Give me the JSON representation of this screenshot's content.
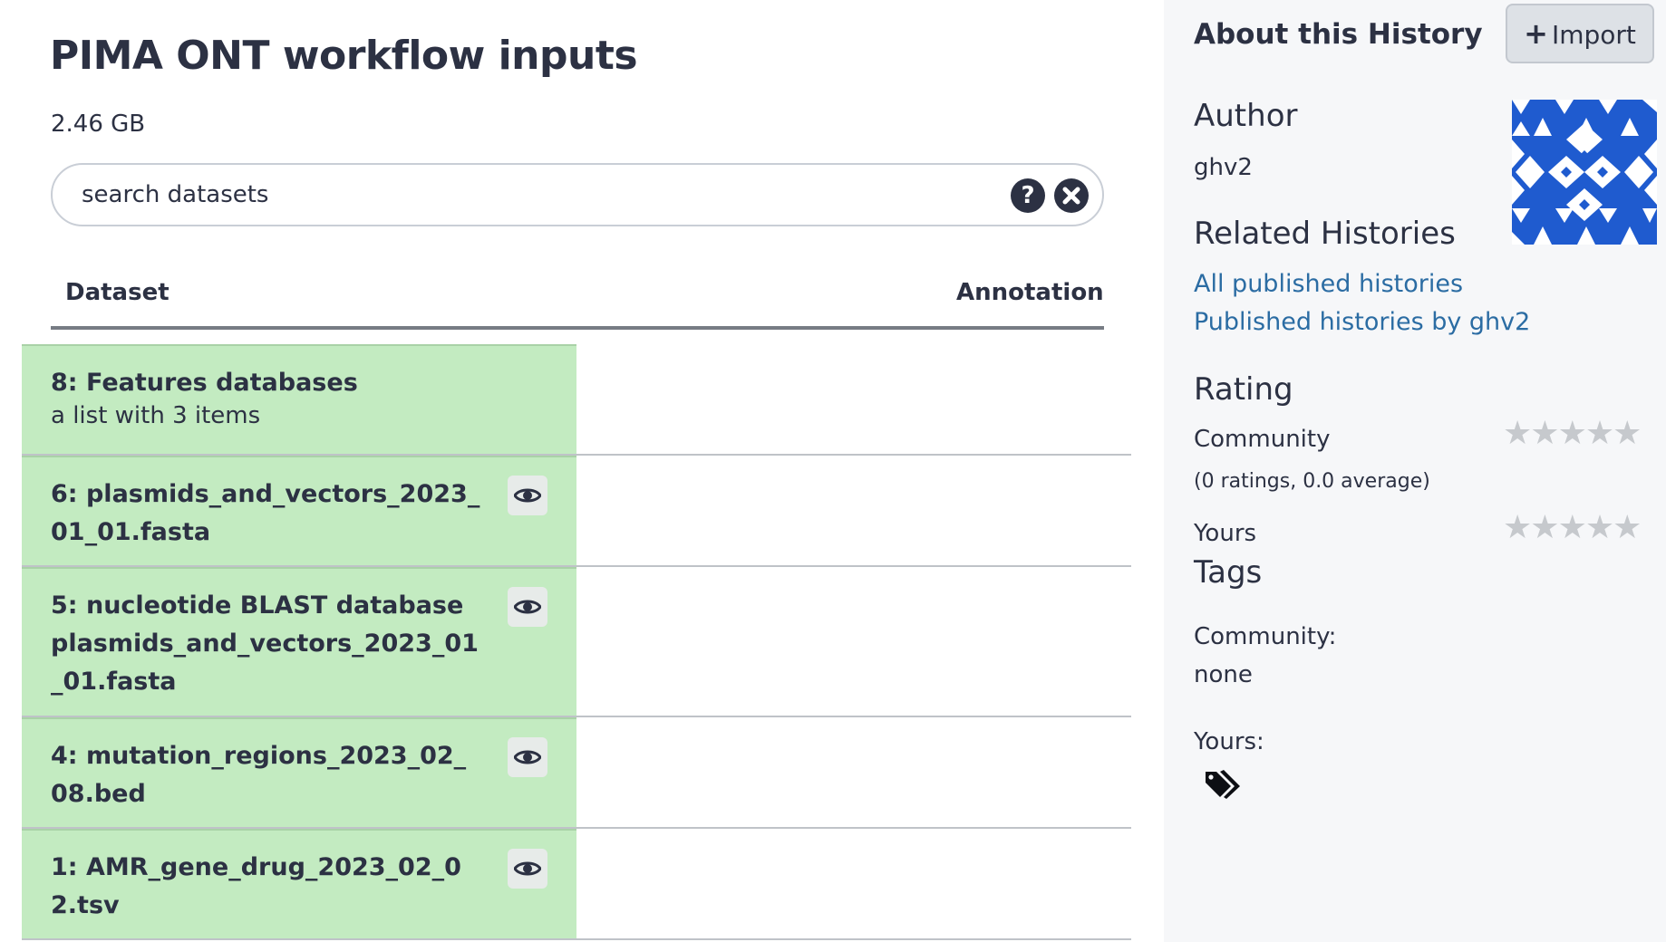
{
  "history": {
    "title": "PIMA ONT workflow inputs",
    "size": "2.46 GB"
  },
  "search": {
    "placeholder": "search datasets",
    "help_icon": "question-circle-icon",
    "clear_icon": "times-circle-icon"
  },
  "table": {
    "columns": [
      "Dataset",
      "Annotation"
    ],
    "rows": [
      {
        "name": "8: Features databases",
        "subtitle": "a list with 3 items",
        "annotation": "",
        "has_eye": false
      },
      {
        "name": "6: plasmids_and_vectors_2023_01_01.fasta",
        "subtitle": "",
        "annotation": "",
        "has_eye": true
      },
      {
        "name": "5: nucleotide BLAST database plasmids_and_vectors_2023_01_01.fasta",
        "subtitle": "",
        "annotation": "",
        "has_eye": true
      },
      {
        "name": "4: mutation_regions_2023_02_08.bed",
        "subtitle": "",
        "annotation": "",
        "has_eye": true
      },
      {
        "name": "1: AMR_gene_drug_2023_02_02.tsv",
        "subtitle": "",
        "annotation": "",
        "has_eye": true
      }
    ],
    "row_colors": {
      "ok": "#c3ebc1"
    }
  },
  "sidebar": {
    "title": "About this History",
    "import_label": "Import",
    "author_heading": "Author",
    "author": "ghv2",
    "related_heading": "Related Histories",
    "links": [
      "All published histories",
      "Published histories by ghv2"
    ],
    "rating_heading": "Rating",
    "community_label": "Community",
    "community_summary": "(0 ratings, 0.0 average)",
    "community_rating": 0,
    "yours_label": "Yours",
    "yours_rating": 0,
    "tags_heading": "Tags",
    "tags_community_label": "Community:",
    "tags_community_value": "none",
    "tags_yours_label": "Yours:",
    "tags_icon": "tags-icon"
  },
  "colors": {
    "text": "#2c3143",
    "link": "#2b6ca3",
    "dataset_ok": "#c3ebc1",
    "sidebar_bg": "#f6f7f9",
    "avatar": "#1f5bcf"
  }
}
